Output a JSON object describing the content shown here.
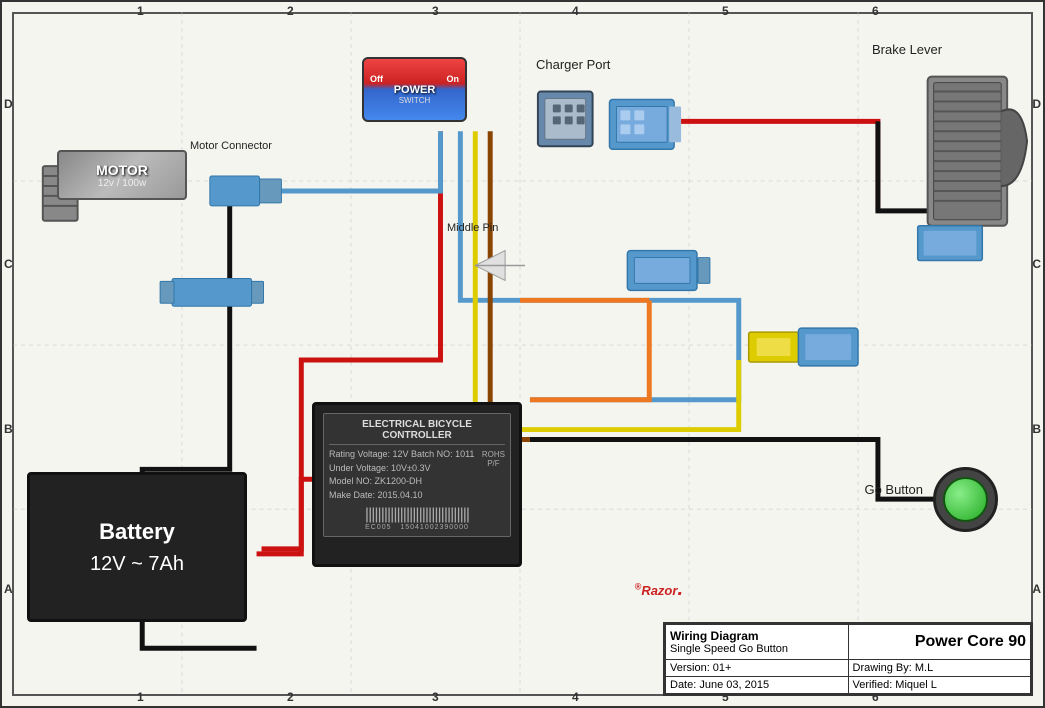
{
  "diagram": {
    "title": "Wiring Diagram",
    "product": "Power Core 90",
    "subtitle": "Single Speed Go Button",
    "version": "Version: 01+",
    "date": "Date: June 03, 2015",
    "drawing_by": "Drawing By: M.L",
    "verified": "Verified: Miquel L",
    "razor_logo": "Razor"
  },
  "components": {
    "motor": {
      "label": "MOTOR",
      "spec": "12v / 100w"
    },
    "battery": {
      "label": "Battery",
      "spec": "12V ~ 7Ah"
    },
    "controller": {
      "title": "ELECTRICAL BICYCLE CONTROLLER",
      "rating": "Rating Voltage: 12V  Batch NO: 1011",
      "under_voltage": "Under Voltage: 10V±0.3V",
      "model": "Model NO: ZK1200-DH",
      "make_date": "Make Date: 2015.04.10",
      "ec": "EC005",
      "barcode_num": "15041002390000",
      "rohs": "ROHS\nP/F"
    },
    "power_switch": {
      "off_label": "Off",
      "on_label": "On",
      "label": "POWER",
      "sublabel": "SWITCH"
    },
    "charger_port": {
      "label": "Charger Port"
    },
    "motor_connector": {
      "label": "Motor Connector"
    },
    "middle_pin": {
      "label": "Middle Pin"
    },
    "brake_lever": {
      "label": "Brake Lever"
    },
    "go_button": {
      "label": "Go Button"
    }
  },
  "grid": {
    "columns": [
      "1",
      "2",
      "3",
      "4",
      "5",
      "6"
    ],
    "rows": [
      "D",
      "C",
      "B",
      "A"
    ]
  }
}
